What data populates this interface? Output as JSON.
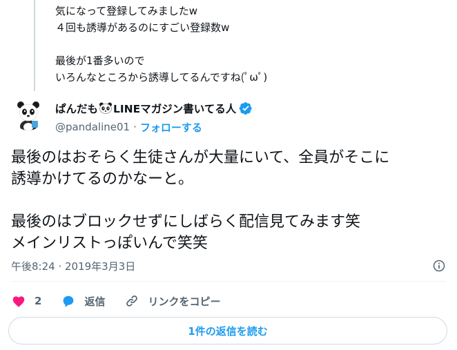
{
  "quoted": {
    "lines": [
      "気になって登録してみましたw",
      "４回も誘導があるのにすごい登録数w",
      "",
      "最後が1番多いので",
      "いろんなところから誘導してるんですね(ﾟωﾟ)"
    ]
  },
  "author": {
    "name_prefix": "ぱんだも",
    "name_suffix": "LINEマガジン書いてる人",
    "handle": "@pandaline01",
    "separator": "·",
    "follow_label": "フォローする",
    "verified_icon": "verified-badge-icon",
    "avatar_icon": "panda-avatar"
  },
  "tweet": {
    "lines": [
      "最後のはおそらく生徒さんが大量にいて、全員がそこに",
      "誘導かけてるのかなーと。",
      "",
      "最後のはブロックせずにしばらく配信見てみます笑",
      "メインリストっぽいんで笑笑"
    ],
    "timestamp": "午後8:24 · 2019年3月3日"
  },
  "actions": {
    "like_count": "2",
    "reply_label": "返信",
    "copy_link_label": "リンクをコピー"
  },
  "read_replies_label": "1件の返信を読む",
  "colors": {
    "accent": "#1d9bf0",
    "like": "#f91880",
    "muted": "#536471",
    "text": "#0f1419"
  }
}
